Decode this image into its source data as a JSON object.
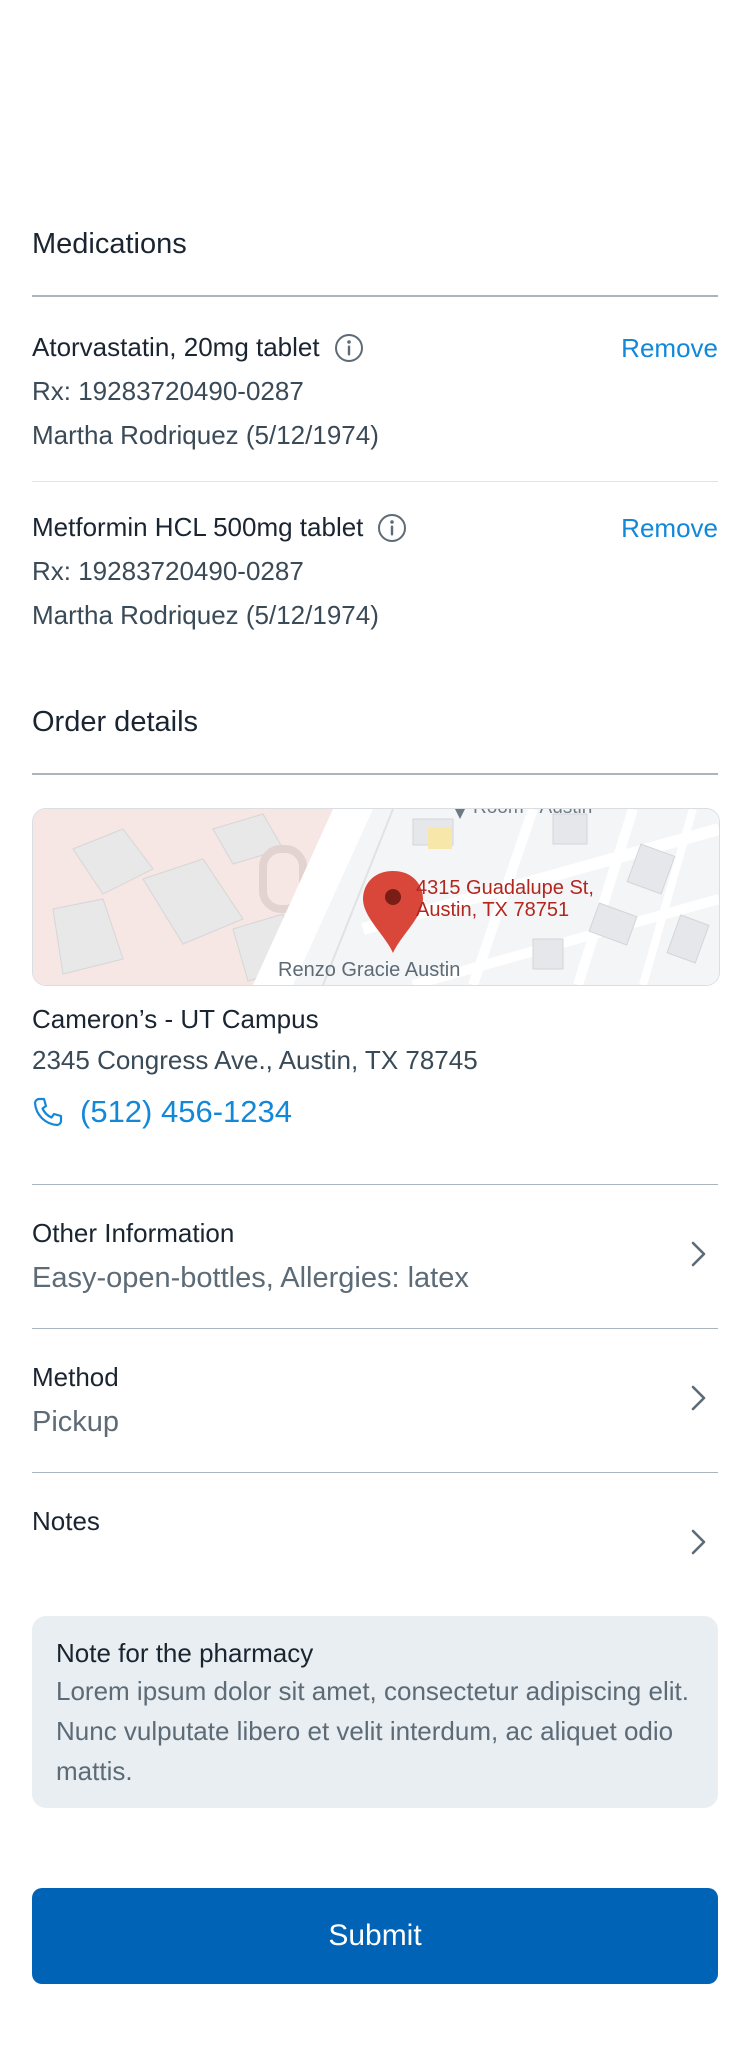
{
  "medications": {
    "title": "Medications",
    "items": [
      {
        "name": "Atorvastatin, 20mg tablet",
        "rx": "Rx: 19283720490-0287",
        "patient": "Martha Rodriquez (5/12/1974)",
        "remove_label": "Remove"
      },
      {
        "name": "Metformin HCL 500mg tablet",
        "rx": "Rx: 19283720490-0287",
        "patient": "Martha Rodriquez (5/12/1974)",
        "remove_label": "Remove"
      }
    ]
  },
  "order": {
    "title": "Order details",
    "map": {
      "pin_label_line1": "4315 Guadalupe St,",
      "pin_label_line2": "Austin, TX 78751",
      "poi_bottom": "Renzo Gracie Austin",
      "poi_top": "Room - Austin"
    },
    "store": {
      "name": "Cameron’s - UT Campus",
      "address": "2345 Congress Ave., Austin, TX 78745",
      "phone": "(512) 456-1234"
    },
    "rows": [
      {
        "label": "Other Information",
        "value": "Easy-open-bottles, Allergies: latex"
      },
      {
        "label": "Method",
        "value": "Pickup"
      },
      {
        "label": "Notes",
        "value": ""
      }
    ],
    "note": {
      "title": "Note for the pharmacy",
      "body": "Lorem ipsum dolor sit amet, consectetur adipiscing elit. Nunc vulputate libero et velit interdum, ac aliquet odio mattis."
    }
  },
  "submit_label": "Submit",
  "colors": {
    "accent": "#1288d8",
    "button": "#0063b5",
    "note_bg": "#e8eef1",
    "pin": "#d9473b"
  },
  "icons": [
    "info-icon",
    "phone-icon",
    "chevron-right-icon",
    "map-pin-icon"
  ]
}
